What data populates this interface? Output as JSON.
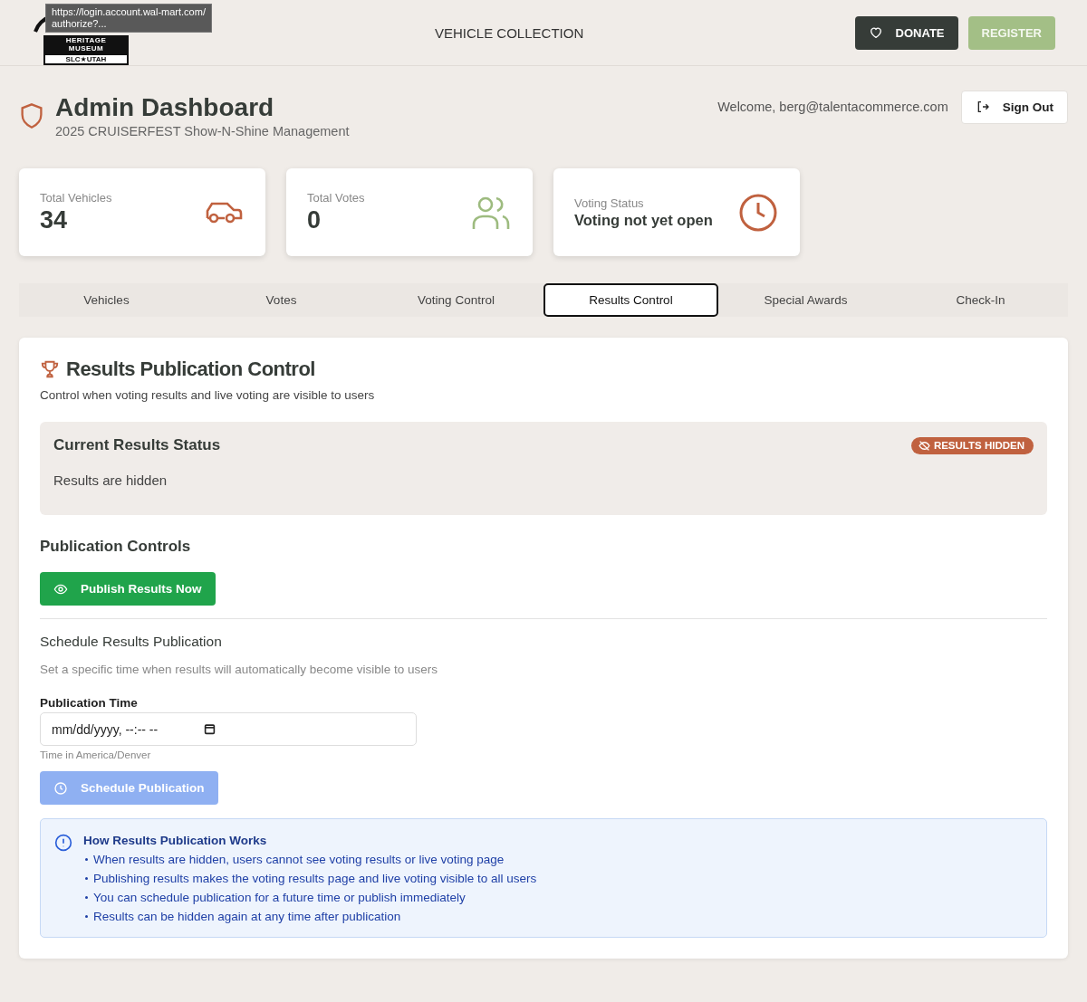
{
  "header": {
    "logo": {
      "line_1": "HERITAGE MUSEUM",
      "line_2": "SLC★UTAH"
    },
    "tooltip": "https://login.account.wal-mart.com/\nauthorize?...",
    "nav_link": "VEHICLE COLLECTION",
    "donate_button": "DONATE",
    "register_button": "REGISTER"
  },
  "dashboard": {
    "title": "Admin Dashboard",
    "subtitle": "2025 CRUISERFEST Show-N-Shine Management",
    "welcome": "Welcome, berg@talentacommerce.com",
    "sign_out_button": "Sign Out"
  },
  "stats": [
    {
      "kind": "car",
      "label": "Total Vehicles",
      "value": "34"
    },
    {
      "kind": "users",
      "label": "Total Votes",
      "value": "0"
    },
    {
      "kind": "clock",
      "label": "Voting Status",
      "value": "Voting not yet open"
    }
  ],
  "tabs": [
    {
      "label": "Vehicles",
      "selected": false
    },
    {
      "label": "Votes",
      "selected": false
    },
    {
      "label": "Voting Control",
      "selected": false
    },
    {
      "label": "Results Control",
      "selected": true
    },
    {
      "label": "Special Awards",
      "selected": false
    },
    {
      "label": "Check-In",
      "selected": false
    }
  ],
  "panel": {
    "title": "Results Publication Control",
    "description": "Control when voting results and live voting are visible to users",
    "status": {
      "title": "Current Results Status",
      "text": "Results are hidden",
      "badge": "RESULTS HIDDEN",
      "published": false
    },
    "controls_title": "Publication Controls",
    "publish_button": "Publish Results Now",
    "schedule": {
      "title": "Schedule Results Publication",
      "description": "Set a specific time when results will automatically become visible to users",
      "field_label": "Publication Time",
      "placeholder": "mm/dd/yyyy, --:-- --",
      "hint": "Time in America/Denver",
      "button": "Schedule Publication",
      "disabled": true
    },
    "info": {
      "title": "How Results Publication Works",
      "items": [
        "When results are hidden, users cannot see voting results or live voting page",
        "Publishing results makes the voting results page and live voting visible to all users",
        "You can schedule publication for a future time or publish immediately",
        "Results can be hidden again at any time after publication"
      ]
    }
  }
}
